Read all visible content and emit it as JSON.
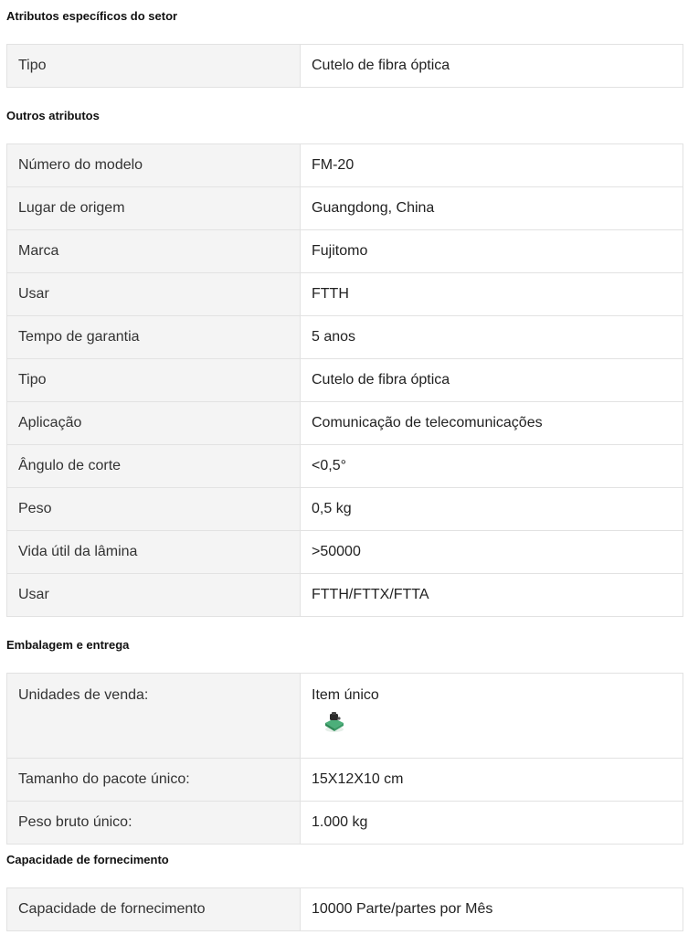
{
  "sections": {
    "industry": {
      "title": "Atributos específicos do setor",
      "rows": [
        {
          "label": "Tipo",
          "value": "Cutelo de fibra óptica"
        }
      ]
    },
    "other": {
      "title": "Outros atributos",
      "rows": [
        {
          "label": "Número do modelo",
          "value": "FM-20"
        },
        {
          "label": "Lugar de origem",
          "value": "Guangdong, China"
        },
        {
          "label": "Marca",
          "value": "Fujitomo"
        },
        {
          "label": "Usar",
          "value": "FTTH"
        },
        {
          "label": "Tempo de garantia",
          "value": "5 anos"
        },
        {
          "label": "Tipo",
          "value": "Cutelo de fibra óptica"
        },
        {
          "label": "Aplicação",
          "value": "Comunicação de telecomunicações"
        },
        {
          "label": "Ângulo de corte",
          "value": "<0,5°"
        },
        {
          "label": "Peso",
          "value": "0,5 kg"
        },
        {
          "label": "Vida útil da lâmina",
          "value": ">50000"
        },
        {
          "label": "Usar",
          "value": "FTTH/FTTX/FTTA"
        }
      ]
    },
    "packaging": {
      "title": "Embalagem e entrega",
      "rows": [
        {
          "label": "Unidades de venda:",
          "value": "Item único",
          "icon": "product-thumbnail-icon"
        },
        {
          "label": "Tamanho do pacote único:",
          "value": "15X12X10 cm"
        },
        {
          "label": "Peso bruto único:",
          "value": "1.000 kg"
        }
      ]
    },
    "supply": {
      "title": "Capacidade de fornecimento",
      "rows": [
        {
          "label": "Capacidade de fornecimento",
          "value": "10000 Parte/partes por Mês"
        }
      ]
    }
  },
  "colors": {
    "key_cell_bg": "#f4f4f4",
    "border": "#e2e2e2",
    "thumbnail_green": "#4caf7a"
  }
}
